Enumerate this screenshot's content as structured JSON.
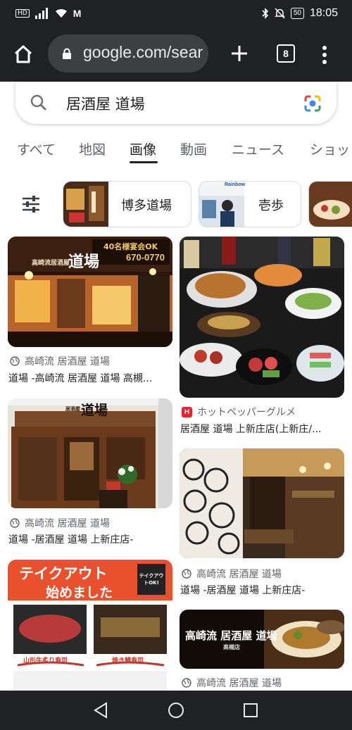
{
  "status_bar": {
    "network_badge": "HD",
    "carrier_icon": "M",
    "battery": "50",
    "time": "18:05",
    "icons": [
      "signal-icon",
      "wifi-icon",
      "bluetooth-icon",
      "mute-icon",
      "battery-icon"
    ]
  },
  "browser": {
    "url": "google.com/sear",
    "tab_count": "8"
  },
  "search": {
    "query": "居酒屋 道場"
  },
  "tabs": [
    {
      "label": "すべて",
      "active": false
    },
    {
      "label": "地図",
      "active": false
    },
    {
      "label": "画像",
      "active": true
    },
    {
      "label": "動画",
      "active": false
    },
    {
      "label": "ニュース",
      "active": false
    },
    {
      "label": "ショッ",
      "active": false
    }
  ],
  "chips": [
    {
      "label": "博多道場"
    },
    {
      "label": "壱歩"
    },
    {
      "label": ""
    }
  ],
  "results": [
    {
      "source": "高崎流 居酒屋 道場",
      "title": "道場 -高崎流 居酒屋 道場 高槻...",
      "overlay": [
        "高崎流居酒屋",
        "道場",
        "40名様宴会OK",
        "670-0770"
      ]
    },
    {
      "source": "ホットペッパーグルメ",
      "title": "居酒屋 道場 上新庄店(上新庄/..."
    },
    {
      "source": "高崎流 居酒屋 道場",
      "title": "道場 -居酒屋 道場 上新庄店-",
      "overlay": [
        "居酒屋",
        "道場"
      ]
    },
    {
      "source": "高崎流 居酒屋 道場",
      "title": "道場 -居酒屋 道場 上新庄店-"
    },
    {
      "source": "",
      "title": "",
      "overlay": [
        "テイクアウト",
        "始めました",
        "テイクアウトOK!",
        "山形牛炙り寿司",
        "焼き鯖寿司"
      ]
    },
    {
      "source": "高崎流 居酒屋 道場",
      "title": "",
      "overlay": [
        "高崎流 居酒屋 道場",
        "高槻店"
      ]
    }
  ],
  "chip_thumb_text": "Rainbow",
  "colors": {
    "bar_bg": "#202124",
    "url_bg": "#3c4043",
    "hotpepper_red": "#e5262d",
    "takeout_orange": "#e8502e"
  }
}
